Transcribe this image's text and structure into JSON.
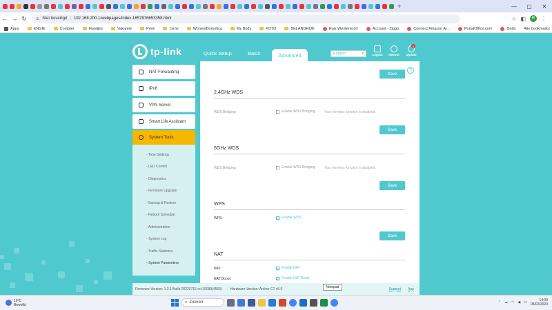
{
  "browser": {
    "address_security": "Niet beveiligd",
    "url": "192.168.200.1/webpages/index.1657876653358.html",
    "bookmarks": [
      "Apps",
      "ENGIE",
      "Compter",
      "Handjes",
      "Vakantie",
      "Prive",
      "Lyme",
      "Wonen/Domotica",
      "My Body",
      "FOTO",
      "BELANGRIJK",
      "Huis Westervoort",
      "Account - Ziggo",
      "Connect Amazon Al...",
      "PortalOffice.com",
      "Delta"
    ],
    "all_bookmarks": "Alle bookmarks",
    "avatar": "R"
  },
  "header": {
    "logo": "tp-link",
    "tabs": [
      "Quick Setup",
      "Basic",
      "Advanced"
    ],
    "language": "English",
    "buttons": [
      "Logout",
      "Reboot",
      "Update"
    ],
    "update_badge": "1"
  },
  "sidebar": {
    "menu": [
      "NAT Forwarding",
      "IPv6",
      "VPN Server",
      "Smart Life Assistant",
      "System Tools"
    ],
    "active": "System Tools",
    "submenu": [
      "Time Settings",
      "LED Control",
      "Diagnostics",
      "Firmware Upgrade",
      "Backup & Restore",
      "Reboot Schedule",
      "Administration",
      "System Log",
      "Traffic Statistics",
      "System Parameters"
    ],
    "current_sub": "System Parameters"
  },
  "content": {
    "save_label": "Save",
    "wds24": {
      "title": "2.4GHz WDS",
      "label": "WDS Bridging:",
      "option": "Enable WDS Bridging",
      "note": "Your wireless function is disabled."
    },
    "wds5": {
      "title": "5GHz WDS",
      "label": "WDS Bridging:",
      "option": "Enable WDS Bridging",
      "note": "Your wireless function is disabled."
    },
    "wps": {
      "title": "WPS",
      "label": "WPS:",
      "option": "Enable WPS",
      "checked": true
    },
    "nat": {
      "title": "NAT",
      "label1": "NAT:",
      "option1": "Enable NAT",
      "label2": "NAT Boost:",
      "option2": "Enable NAT Boost"
    }
  },
  "footer": {
    "firmware": "Firmware Version: 1.2.1 Build 20220715 rel.19099(4553)",
    "hardware": "Hardware Version: Archer C7 v5.0",
    "support": "Support",
    "app": "App",
    "tooltip": "Notepad"
  },
  "taskbar": {
    "weather_temp": "10°C",
    "weather_desc": "Bewolkt",
    "weather_badge": "1",
    "search": "Zoeken",
    "time": "14:00",
    "date": "05/02/2024"
  }
}
